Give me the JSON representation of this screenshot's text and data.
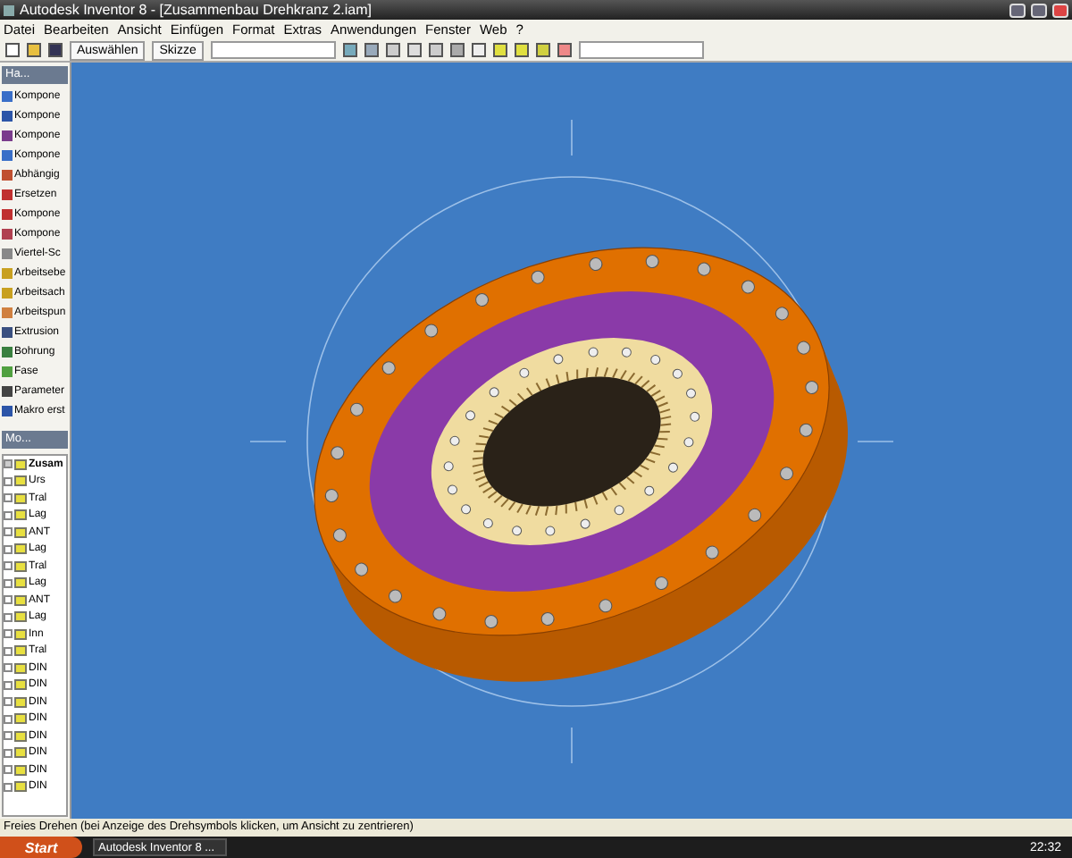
{
  "window": {
    "title": "Autodesk Inventor 8 - [Zusammenbau Drehkranz 2.iam]"
  },
  "menu": [
    "Datei",
    "Bearbeiten",
    "Ansicht",
    "Einfügen",
    "Format",
    "Extras",
    "Anwendungen",
    "Fenster",
    "Web",
    "?"
  ],
  "toolbar": {
    "select_button": "Auswählen",
    "sketch_button": "Skizze"
  },
  "panel_bar": {
    "title": "Ha..."
  },
  "panel_items": [
    "Kompone",
    "Kompone",
    "Kompone",
    "Kompone",
    "Abhängig",
    "Ersetzen",
    "Kompone",
    "Kompone",
    "Viertel-Sc",
    "Arbeitsebe",
    "Arbeitsach",
    "Arbeitspun",
    "Extrusion",
    "Bohrung",
    "Fase",
    "Parameter",
    "Makro erst"
  ],
  "browser": {
    "title": "Mo...",
    "tree": [
      {
        "label": "Zusam",
        "expanded": true,
        "children": [
          {
            "label": "Urs",
            "expanded": false
          },
          {
            "label": "Tral",
            "expanded": false
          },
          {
            "label": "Lag",
            "expanded": false
          },
          {
            "label": "ANT",
            "expanded": false
          },
          {
            "label": "Lag",
            "expanded": false
          },
          {
            "label": "Tral",
            "expanded": false
          },
          {
            "label": "Lag",
            "expanded": false
          },
          {
            "label": "ANT",
            "expanded": false
          },
          {
            "label": "Lag",
            "expanded": false
          },
          {
            "label": "Inn",
            "expanded": false
          },
          {
            "label": "Tral",
            "expanded": false
          },
          {
            "label": "DIN",
            "expanded": false
          },
          {
            "label": "DIN",
            "expanded": false
          },
          {
            "label": "DIN",
            "expanded": false
          },
          {
            "label": "DIN",
            "expanded": false
          },
          {
            "label": "DIN",
            "expanded": false
          },
          {
            "label": "DIN",
            "expanded": false
          },
          {
            "label": "DIN",
            "expanded": false
          },
          {
            "label": "DIN",
            "expanded": false
          }
        ]
      }
    ]
  },
  "status_bar": "Freies Drehen (bei Anzeige des Drehsymbols klicken, um Ansicht zu zentrieren)",
  "taskbar": {
    "start": "Start",
    "tasks": [
      {
        "label": "Autodesk Inventor 8 ...",
        "selected": false
      }
    ],
    "clock": "22:32"
  }
}
